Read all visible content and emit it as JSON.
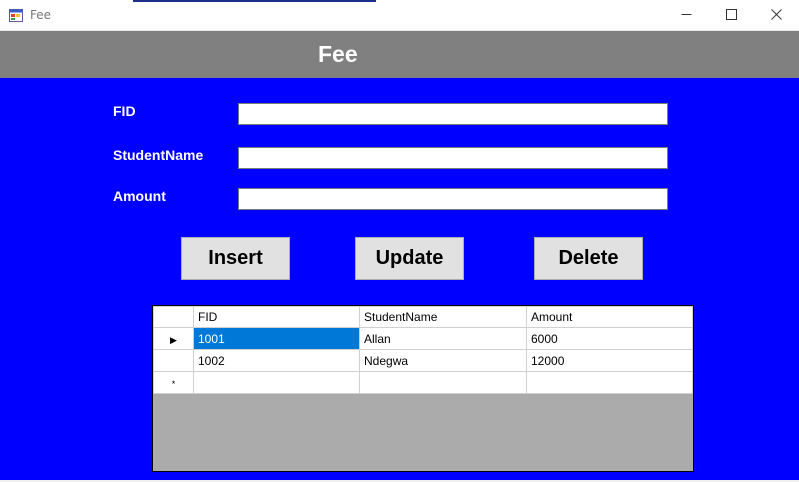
{
  "window": {
    "title": "Fee",
    "icons": {
      "app": "app-form-icon",
      "minimize": "minimize-icon",
      "maximize": "maximize-icon",
      "close": "close-icon"
    }
  },
  "header": {
    "title": "Fee"
  },
  "form": {
    "fid_label": "FID",
    "fid_value": "",
    "student_label": "StudentName",
    "student_value": "",
    "amount_label": "Amount",
    "amount_value": ""
  },
  "buttons": {
    "insert": "Insert",
    "update": "Update",
    "delete": "Delete"
  },
  "grid": {
    "columns": [
      "FID",
      "StudentName",
      "Amount"
    ],
    "rows": [
      {
        "fid": "1001",
        "name": "Allan",
        "amount": "6000"
      },
      {
        "fid": "1002",
        "name": "Ndegwa",
        "amount": "12000"
      }
    ],
    "current_row_indicator": "▶",
    "new_row_indicator": "*"
  },
  "colors": {
    "client_background": "#0000ff",
    "header_background": "#808080",
    "selection": "#0078d7"
  }
}
